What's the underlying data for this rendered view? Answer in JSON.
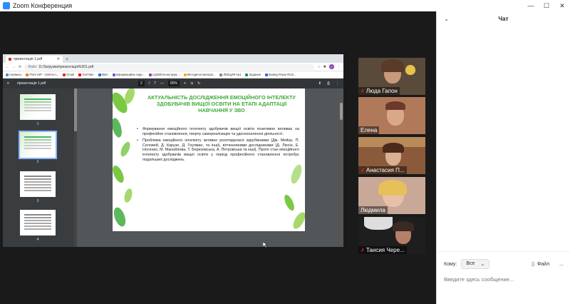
{
  "window": {
    "title": "Zoom Конференция",
    "controls": [
      "—",
      "☐",
      "✕"
    ]
  },
  "browser": {
    "tab_title": "презентація 1.pdf",
    "new_tab": "+",
    "address": {
      "prefix": "Файл",
      "path": "D:/Загрузки/презентація%201.pdf"
    },
    "profile_initial": "С",
    "bookmarks": [
      "Сервисы",
      "Point SIP - Святосл...",
      "Gmail",
      "YouTube",
      "Main",
      "Інформаційна скри...",
      "Lightshot-инструм...",
      "Методичні матеріа...",
      "ЛЕКЦИЯ №1",
      "Задания",
      "Вывод Реуке RUS..."
    ],
    "bookmark_colors": [
      "#4a90d9",
      "#e67e22",
      "#d93025",
      "#ff0000",
      "#1a73e8",
      "#6a5acd",
      "#8e44ad",
      "#f4b400",
      "#888888",
      "#0f9d58",
      "#3367d6"
    ],
    "pdf_toolbar": {
      "file_name": "презентація 1.pdf",
      "page_current": "2",
      "page_sep": "/",
      "page_total": "7",
      "zoom_minus": "—",
      "zoom": "80%",
      "zoom_plus": "+"
    },
    "thumbnails": [
      "1",
      "2",
      "3",
      "4"
    ]
  },
  "slide": {
    "title": "АКТУАЛЬНІСТЬ ДОСЛІДЖЕННЯ ЕМОЦІЙНОГО ІНТЕЛЕКТУ ЗДОБУВАЧІВ ВИЩОЇ ОСВІТИ НА ЕТАПІ АДАПТАЦІЇ НАВЧАННЯ У ЗВО",
    "bullets": [
      "Формування емоційного інтелекту здобувачів вищої освіти позитивно впливає на професійне становлення, творчу самореалізацію та удосконалення діяльності.",
      "Проблема емоційного інтелекту активно розглядалася зарубіжними (Дж. Мейєр, П. Селовей, Д. Карузо, Д. Гоулман, та інші), вітчизняними дослідниками (Д. Люсін, Е. Носенко, М. Манойлова, Т. Березовська, А. Петровська та інші). Проте стан емоційного інтелекту здобувачів вищої освіти у період професійного становлення потребує подальших досліджень."
    ]
  },
  "participants": [
    {
      "name": "Люда Гапон",
      "muted": true
    },
    {
      "name": "Елена",
      "muted": false
    },
    {
      "name": "Анастасия П...",
      "muted": true
    },
    {
      "name": "Людмила",
      "muted": false
    },
    {
      "name": "Таисия Чере...",
      "muted": true
    }
  ],
  "chat": {
    "title": "Чат",
    "to_label": "Кому:",
    "to_value": "Все",
    "file_label": "Файл",
    "more": "...",
    "placeholder": "Введите здесь сообщение..."
  }
}
